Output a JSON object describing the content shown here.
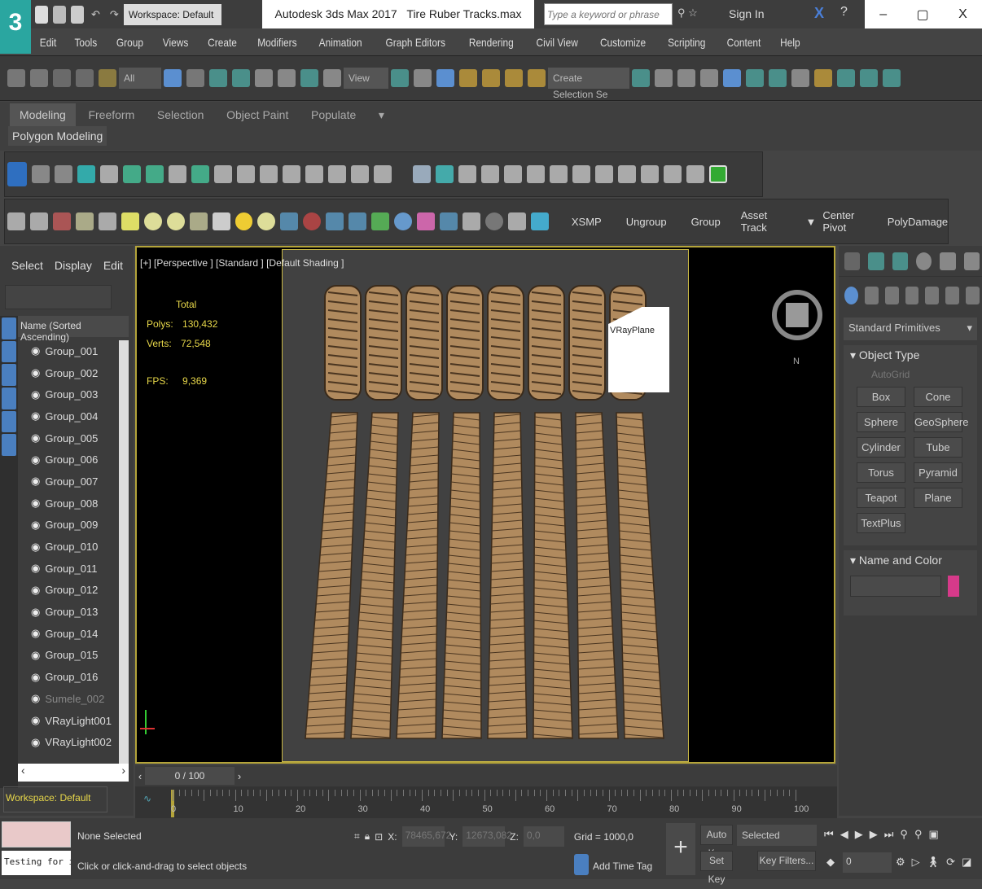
{
  "title_bar": {
    "workspace": "Workspace: Default",
    "app_title": "Autodesk 3ds Max 2017",
    "file_name": "Tire Ruber Tracks.max",
    "search_placeholder": "Type a keyword or phrase",
    "sign_in": "Sign In",
    "minimize": "–",
    "restore": "▢",
    "close": "X"
  },
  "logo": "3",
  "menu": [
    "Edit",
    "Tools",
    "Group",
    "Views",
    "Create",
    "Modifiers",
    "Animation",
    "Graph Editors",
    "Rendering",
    "Civil View",
    "Customize",
    "Scripting",
    "Content",
    "Help"
  ],
  "toolbar": {
    "filter": "All",
    "ref_coord": "View",
    "selection_set": "Create Selection Se"
  },
  "ribbon": {
    "tabs": [
      "Modeling",
      "Freeform",
      "Selection",
      "Object Paint",
      "Populate"
    ],
    "panel": "Polygon Modeling"
  },
  "quick_buttons": [
    "XSMP",
    "Ungroup",
    "Group",
    "Asset Track",
    "Center Pivot",
    "PolyDamage"
  ],
  "scene_explorer": {
    "tabs": [
      "Select",
      "Display",
      "Edit"
    ],
    "column": "Name (Sorted Ascending)",
    "items": [
      "Group_001",
      "Group_002",
      "Group_003",
      "Group_004",
      "Group_005",
      "Group_006",
      "Group_007",
      "Group_008",
      "Group_009",
      "Group_010",
      "Group_011",
      "Group_012",
      "Group_013",
      "Group_014",
      "Group_015",
      "Group_016",
      "Sumele_002",
      "VRayLight001",
      "VRayLight002"
    ],
    "workspace": "Workspace: Default"
  },
  "viewport": {
    "label": "[+] [Perspective ] [Standard ] [Default Shading ]",
    "stats_header": "Total",
    "polys_label": "Polys:",
    "polys": "130,432",
    "verts_label": "Verts:",
    "verts": "72,548",
    "fps_label": "FPS:",
    "fps": "9,369",
    "object_label": "VRayPlane"
  },
  "command_panel": {
    "category": "Standard Primitives",
    "object_type": "Object Type",
    "autogrid": "AutoGrid",
    "buttons": [
      "Box",
      "Cone",
      "Sphere",
      "GeoSphere",
      "Cylinder",
      "Tube",
      "Torus",
      "Pyramid",
      "Teapot",
      "Plane",
      "TextPlus"
    ],
    "name_color": "Name and Color",
    "color": "#d63a8a"
  },
  "timeline": {
    "frame": "0 / 100",
    "ticks": [
      "0",
      "10",
      "20",
      "30",
      "40",
      "50",
      "60",
      "70",
      "80",
      "90",
      "100"
    ]
  },
  "status": {
    "selection": "None Selected",
    "prompt": "Click or click-and-drag to select objects",
    "script_text": "Testing for i",
    "x_label": "X:",
    "x": "78465,672",
    "y_label": "Y:",
    "y": "12673,082",
    "z_label": "Z:",
    "z": "0,0",
    "grid": "Grid = 1000,0",
    "add_time_tag": "Add Time Tag",
    "auto_key": "Auto Key",
    "key_mode": "Selected",
    "set_key": "Set Key",
    "key_filters": "Key Filters...",
    "current_frame": "0"
  }
}
